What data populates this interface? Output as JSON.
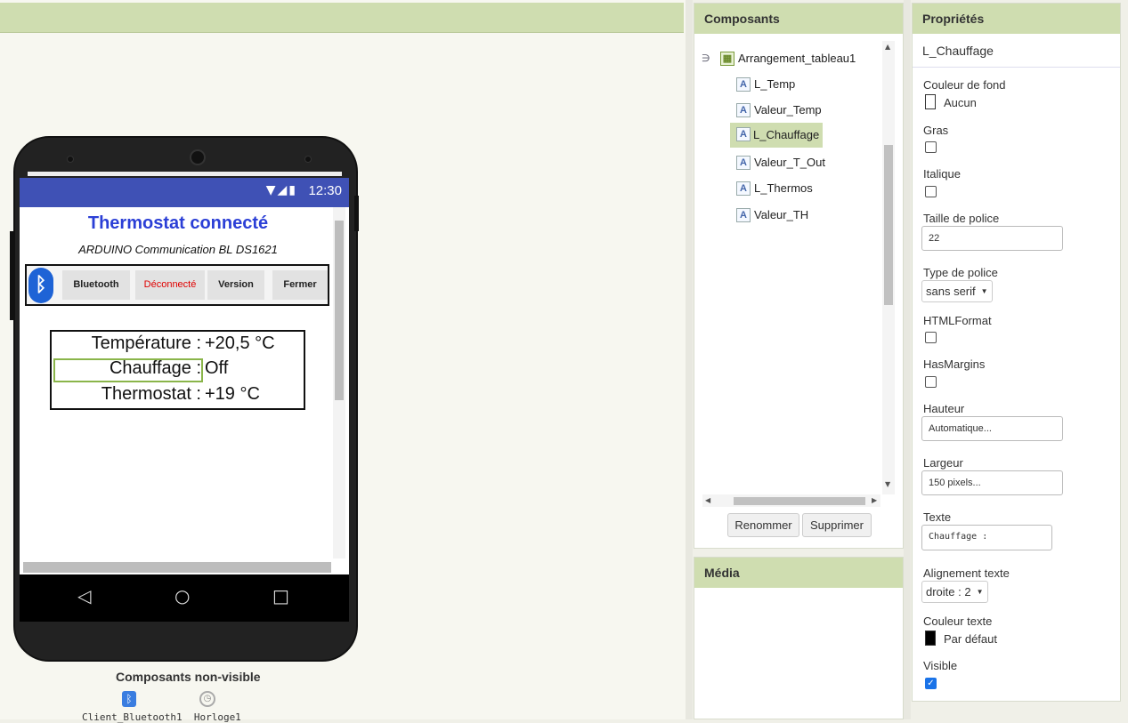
{
  "app": {
    "title": "Thermostat connecté",
    "subtitle": "ARDUINO Communication BL DS1621",
    "status_time": "12:30",
    "buttons": {
      "bluetooth": "Bluetooth",
      "disconnected": "Déconnecté",
      "version": "Version",
      "close": "Fermer"
    },
    "rows": [
      {
        "label": "Température :",
        "value": "+20,5 °C"
      },
      {
        "label": "Chauffage :",
        "value": "Off"
      },
      {
        "label": "Thermostat :",
        "value": "+19 °C"
      }
    ]
  },
  "nonvisible": {
    "title": "Composants non-visible",
    "labels": "Client_Bluetooth1  Horloge1"
  },
  "components": {
    "title": "Composants",
    "tree": [
      {
        "label": "Arrangement_tableau1",
        "icon": "table-arrangement-icon"
      },
      {
        "label": "L_Temp",
        "icon": "label-icon"
      },
      {
        "label": "Valeur_Temp",
        "icon": "label-icon"
      },
      {
        "label": "L_Chauffage",
        "icon": "label-icon",
        "selected": true
      },
      {
        "label": "Valeur_T_Out",
        "icon": "label-icon"
      },
      {
        "label": "L_Thermos",
        "icon": "label-icon"
      },
      {
        "label": "Valeur_TH",
        "icon": "label-icon"
      }
    ],
    "rename_button": "Renommer",
    "delete_button": "Supprimer"
  },
  "media": {
    "title": "Média"
  },
  "properties": {
    "title": "Propriétés",
    "component": "L_Chauffage",
    "bg_color_label": "Couleur de fond",
    "bg_color_value": "Aucun",
    "bold_label": "Gras",
    "italic_label": "Italique",
    "font_size_label": "Taille de police",
    "font_size_value": "22",
    "font_type_label": "Type de police",
    "font_type_value": "sans serif",
    "html_label": "HTMLFormat",
    "margins_label": "HasMargins",
    "height_label": "Hauteur",
    "height_value": "Automatique...",
    "width_label": "Largeur",
    "width_value": "150 pixels...",
    "text_label": "Texte",
    "text_value": "Chauffage :",
    "align_label": "Alignement texte",
    "align_value": "droite : 2",
    "text_color_label": "Couleur texte",
    "text_color_value": "Par défaut",
    "visible_label": "Visible",
    "visible_checked": true
  },
  "colors": {
    "accent": "#cfddb0",
    "appbar": "#3f51b5",
    "title_blue": "#2b3fd6",
    "disconnected_red": "#e00000"
  }
}
